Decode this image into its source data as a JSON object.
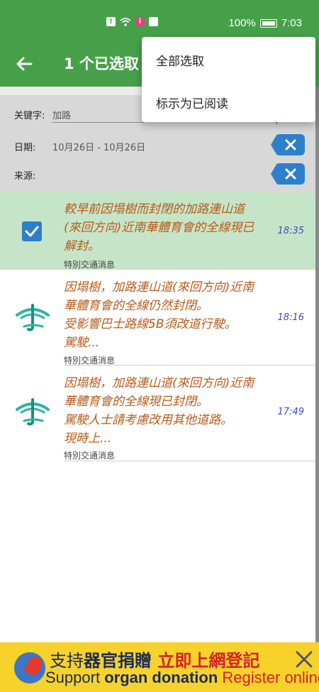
{
  "status_bar": {
    "battery": "100%",
    "time": "7:03",
    "icons": [
      "alert-icon",
      "wifi-icon",
      "info-icon",
      "message-icon"
    ]
  },
  "app_bar": {
    "title": "1 个已选取",
    "back_icon": "arrow-left-icon"
  },
  "menu": {
    "items": [
      "全部选取",
      "标示为已阅读"
    ]
  },
  "filters": {
    "keyword_label": "关键字:",
    "keyword_value": "加路",
    "date_label": "日期:",
    "date_value": "10月26日 - 10月26日",
    "source_label": "来源:",
    "clear_icon": "close-icon"
  },
  "messages": [
    {
      "title_lines": [
        "較早前因塌樹而封閉的加路連山道",
        "(來回方向)近南華體育會的全線現已",
        "解封。"
      ],
      "time": "18:35",
      "category": "特別交通消息",
      "selected": true
    },
    {
      "title_lines": [
        "因塌樹，加路連山道(來回方向)近南",
        "華體育會的全線仍然封閉。",
        "受影響巴士路線5B須改道行駛。",
        "駕駛..."
      ],
      "time": "18:16",
      "category": "特別交通消息",
      "selected": false
    },
    {
      "title_lines": [
        "因塌樹，加路連山道(來回方向)近南",
        "華體育會的全線現已封閉。",
        "駕駛人士請考慮改用其他道路。",
        "現時上..."
      ],
      "time": "17:49",
      "category": "特別交通消息",
      "selected": false
    }
  ],
  "ad": {
    "line1_a": "支持",
    "line1_b": "器官捐贈",
    "line1_c": "立即上網登記",
    "line2_a": "Support",
    "line2_b": "organ donation",
    "line2_c": "Register online!"
  },
  "colors": {
    "primary": "#46a04a",
    "selected_row": "#c6e5c8",
    "title_text": "#b85a1a",
    "time_text": "#3a4bb8",
    "accent_blue": "#2e7fcb",
    "ad_bg": "#f6d22b"
  }
}
